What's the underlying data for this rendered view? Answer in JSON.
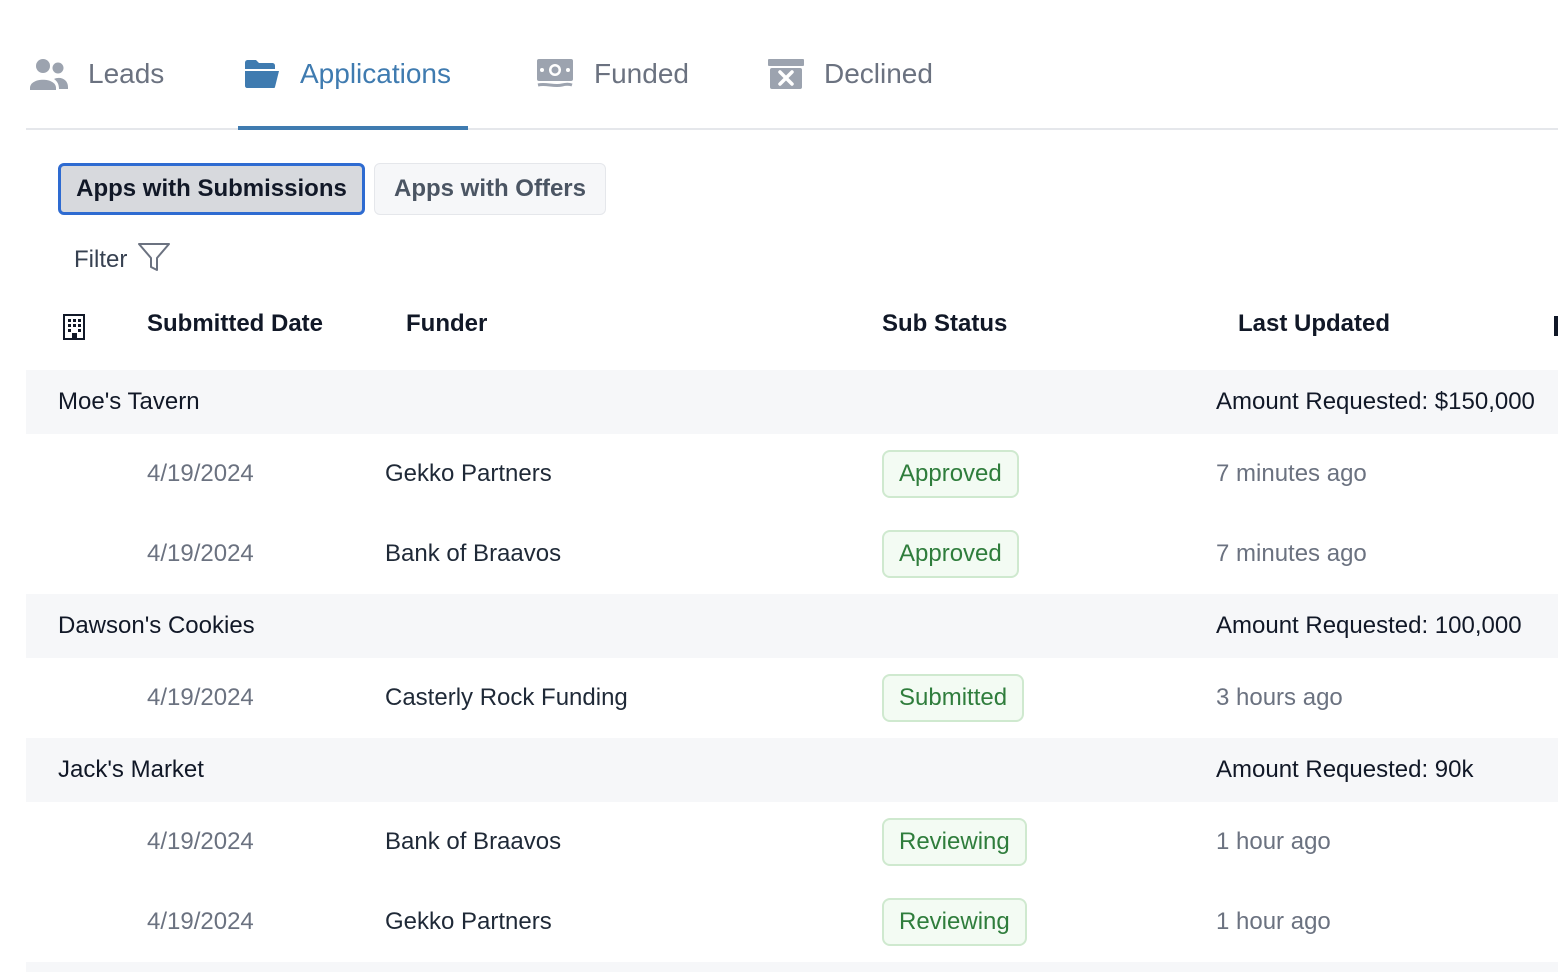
{
  "tabs": [
    {
      "label": "Leads",
      "icon": "users-icon",
      "active": false
    },
    {
      "label": "Applications",
      "icon": "folder-open-icon",
      "active": true
    },
    {
      "label": "Funded",
      "icon": "money-icon",
      "active": false
    },
    {
      "label": "Declined",
      "icon": "archive-x-icon",
      "active": false
    }
  ],
  "segments": {
    "submissions_label": "Apps with Submissions",
    "offers_label": "Apps with Offers"
  },
  "filter": {
    "label": "Filter",
    "icon": "filter-icon"
  },
  "table": {
    "columns": {
      "icon": "building-icon",
      "submitted_date": "Submitted Date",
      "funder": "Funder",
      "sub_status": "Sub Status",
      "last_updated": "Last Updated"
    },
    "groups": [
      {
        "name": "Moe's Tavern",
        "amount": "Amount Requested: $150,000",
        "rows": [
          {
            "date": "4/19/2024",
            "funder": "Gekko Partners",
            "status": "Approved",
            "updated": "7 minutes ago"
          },
          {
            "date": "4/19/2024",
            "funder": "Bank of Braavos",
            "status": "Approved",
            "updated": "7 minutes ago"
          }
        ]
      },
      {
        "name": "Dawson's Cookies",
        "amount": "Amount Requested: 100,000",
        "rows": [
          {
            "date": "4/19/2024",
            "funder": "Casterly Rock Funding",
            "status": "Submitted",
            "updated": "3 hours ago"
          }
        ]
      },
      {
        "name": "Jack's Market",
        "amount": "Amount Requested: 90k",
        "rows": [
          {
            "date": "4/19/2024",
            "funder": "Bank of Braavos",
            "status": "Reviewing",
            "updated": "1 hour ago"
          },
          {
            "date": "4/19/2024",
            "funder": "Gekko Partners",
            "status": "Reviewing",
            "updated": "1 hour ago"
          }
        ]
      }
    ]
  },
  "colors": {
    "accent": "#3f7bb0",
    "status_text": "#2f7d3c",
    "status_bg": "#f3fbf3",
    "group_bg": "#f6f7f9",
    "focus_ring": "#2e6bd1"
  }
}
